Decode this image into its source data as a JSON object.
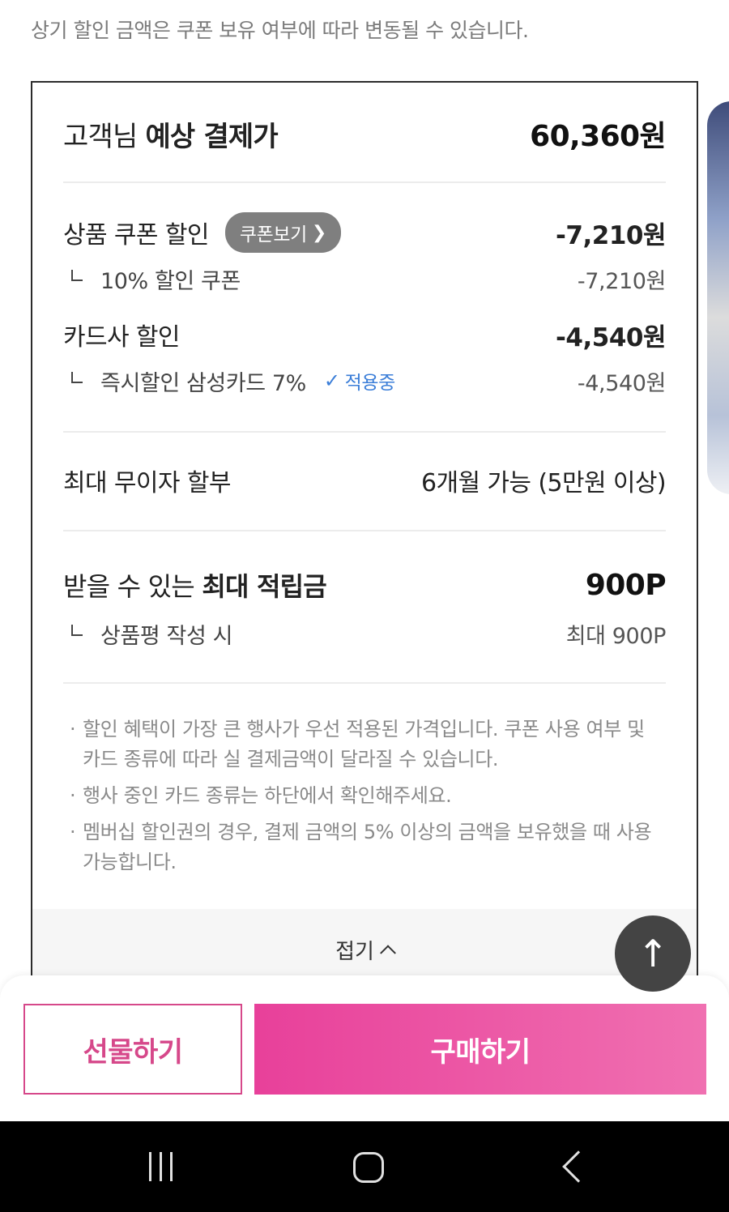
{
  "notice": "상기 할인 금액은 쿠폰 보유 여부에 따라 변동될 수 있습니다.",
  "summary": {
    "title_prefix": "고객님 ",
    "title_bold": "예상 결제가",
    "amount": "60,360원"
  },
  "coupon_discount": {
    "label": "상품 쿠폰 할인",
    "button_label": "쿠폰보기",
    "amount": "-7,210원",
    "sub_label": "10% 할인 쿠폰",
    "sub_amount": "-7,210원"
  },
  "card_discount": {
    "label": "카드사 할인",
    "amount": "-4,540원",
    "sub_label": "즉시할인 삼성카드 7%",
    "applied_label": "적용중",
    "sub_amount": "-4,540원"
  },
  "installment": {
    "label": "최대 무이자 할부",
    "value": "6개월 가능 (5만원 이상)"
  },
  "points": {
    "label_prefix": "받을 수 있는 ",
    "label_bold": "최대 적립금",
    "value": "900P",
    "sub_label": "상품평 작성 시",
    "sub_value": "최대 900P"
  },
  "notes": [
    "할인 혜택이 가장 큰 행사가 우선 적용된 가격입니다. 쿠폰 사용 여부 및 카드 종류에 따라 실 결제금액이 달라질 수 있습니다.",
    "행사 중인 카드 종류는 하단에서 확인해주세요.",
    "멤버십 할인권의 경우, 결제 금액의 5% 이상의 금액을 보유했을 때 사용 가능합니다."
  ],
  "fold_label": "접기",
  "actions": {
    "gift_label": "선물하기",
    "buy_label": "구매하기"
  },
  "colors": {
    "accent_pink": "#e8409a",
    "applied_blue": "#3b7ed8"
  },
  "icons": {
    "scroll_top": "arrow-up-icon",
    "applied": "check-icon",
    "coupon_chevron": "chevron-right-icon",
    "fold_caret": "chevron-up-icon"
  }
}
